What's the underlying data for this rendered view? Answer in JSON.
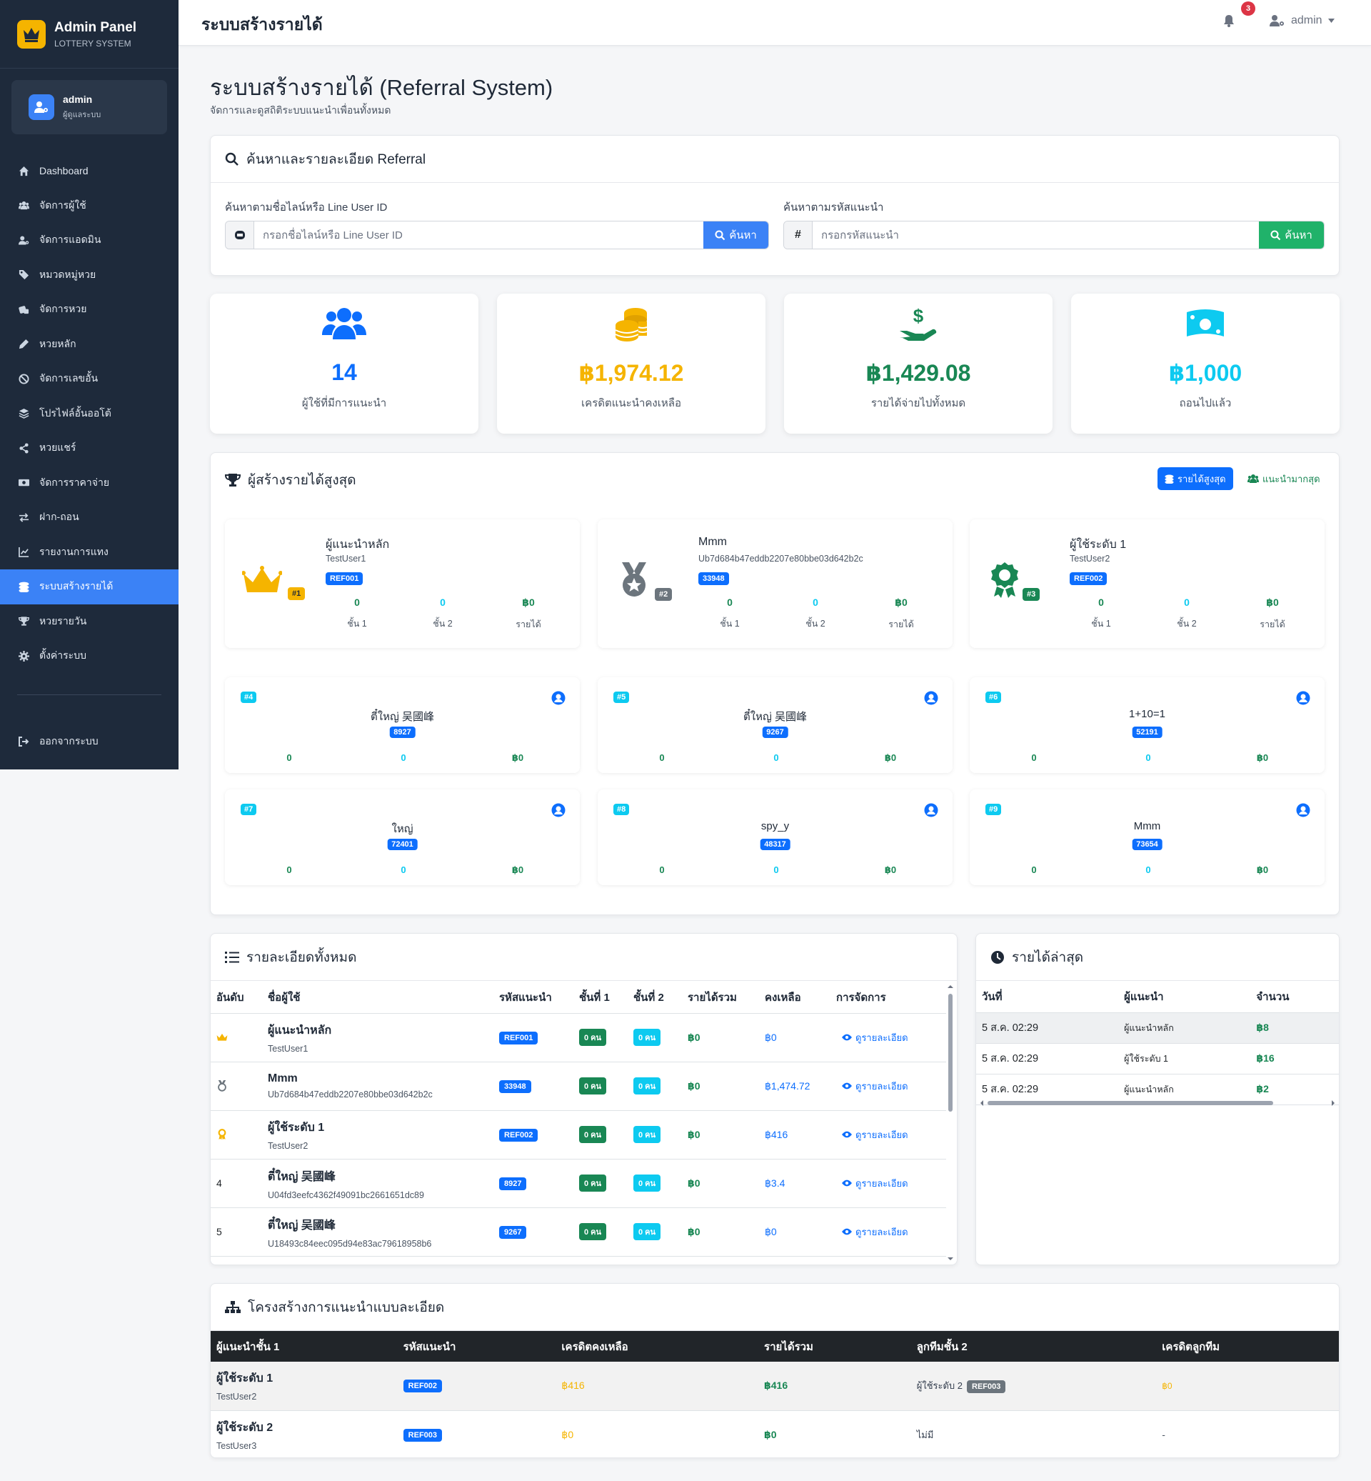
{
  "sidebar": {
    "brand_title": "Admin Panel",
    "brand_sub": "LOTTERY SYSTEM",
    "user_name": "admin",
    "user_role": "ผู้ดูแลระบบ",
    "items": [
      {
        "label": "Dashboard",
        "icon": "home-icon"
      },
      {
        "label": "จัดการผู้ใช้",
        "icon": "users-icon"
      },
      {
        "label": "จัดการแอดมิน",
        "icon": "user-cog-icon"
      },
      {
        "label": "หมวดหมู่หวย",
        "icon": "tags-icon"
      },
      {
        "label": "จัดการหวย",
        "icon": "dice-icon"
      },
      {
        "label": "หวยหลัก",
        "icon": "pen-icon"
      },
      {
        "label": "จัดการเลขอั้น",
        "icon": "ban-icon"
      },
      {
        "label": "โปรไฟล์อั้นออโต้",
        "icon": "layers-icon"
      },
      {
        "label": "หวยแชร์",
        "icon": "share-icon"
      },
      {
        "label": "จัดการราคาจ่าย",
        "icon": "money-icon"
      },
      {
        "label": "ฝาก-ถอน",
        "icon": "exchange-icon"
      },
      {
        "label": "รายงานการแทง",
        "icon": "chart-line-icon"
      },
      {
        "label": "ระบบสร้างรายได้",
        "icon": "coins-icon",
        "active": true
      },
      {
        "label": "หวยรายวัน",
        "icon": "trophy-icon"
      },
      {
        "label": "ตั้งค่าระบบ",
        "icon": "gear-icon"
      }
    ],
    "logout_label": "ออกจากระบบ"
  },
  "topbar": {
    "title": "ระบบสร้างรายได้",
    "notif_count": "3",
    "user_label": "admin"
  },
  "page": {
    "title": "ระบบสร้างรายได้ (Referral System)",
    "subtitle": "จัดการและดูสถิติระบบแนะนำเพื่อนทั้งหมด"
  },
  "search": {
    "title": "ค้นหาและรายละเอียด Referral",
    "line_label": "ค้นหาตามชื่อไลน์หรือ Line User ID",
    "line_placeholder": "กรอกชื่อไลน์หรือ Line User ID",
    "code_label": "ค้นหาตามรหัสแนะนำ",
    "code_prefix": "#",
    "code_placeholder": "กรอกรหัสแนะนำ",
    "button": "ค้นหา"
  },
  "stats": [
    {
      "value": "14",
      "label": "ผู้ใช้ที่มีการแนะนำ",
      "color": "#0d6efd",
      "icon": "users-icon"
    },
    {
      "value": "฿1,974.12",
      "label": "เครดิตแนะนำคงเหลือ",
      "color": "#f5b400",
      "icon": "coins-icon"
    },
    {
      "value": "฿1,429.08",
      "label": "รายได้จ่ายไปทั้งหมด",
      "color": "#198754",
      "icon": "hand-dollar-icon"
    },
    {
      "value": "฿1,000",
      "label": "ถอนไปแล้ว",
      "color": "#0dcaf0",
      "icon": "money-bill-icon"
    }
  ],
  "top": {
    "title": "ผู้สร้างรายได้สูงสุด",
    "tab_income": "รายได้สูงสุด",
    "tab_referrals": "แนะนำมากสุด",
    "stat_labels": {
      "l1": "ชั้น 1",
      "l2": "ชั้น 2",
      "income": "รายได้"
    },
    "podium": [
      {
        "rank": "#1",
        "name": "ผู้แนะนำหลัก",
        "sub": "TestUser1",
        "code": "REF001",
        "l1": "0",
        "l2": "0",
        "income": "฿0"
      },
      {
        "rank": "#2",
        "name": "Mmm",
        "sub": "Ub7d684b47eddb2207e80bbe03d642b2c",
        "code": "33948",
        "l1": "0",
        "l2": "0",
        "income": "฿0"
      },
      {
        "rank": "#3",
        "name": "ผู้ใช้ระดับ 1",
        "sub": "TestUser2",
        "code": "REF002",
        "l1": "0",
        "l2": "0",
        "income": "฿0"
      }
    ],
    "others": [
      {
        "rank": "#4",
        "name": "ตี๋ใหญ่ 吴國峰",
        "code": "8927",
        "l1": "0",
        "l2": "0",
        "income": "฿0"
      },
      {
        "rank": "#5",
        "name": "ตี๋ใหญ่ 吴國峰",
        "code": "9267",
        "l1": "0",
        "l2": "0",
        "income": "฿0"
      },
      {
        "rank": "#6",
        "name": "1+10=1",
        "code": "52191",
        "l1": "0",
        "l2": "0",
        "income": "฿0"
      },
      {
        "rank": "#7",
        "name": "ใหญ่",
        "code": "72401",
        "l1": "0",
        "l2": "0",
        "income": "฿0"
      },
      {
        "rank": "#8",
        "name": "spy_y",
        "code": "48317",
        "l1": "0",
        "l2": "0",
        "income": "฿0"
      },
      {
        "rank": "#9",
        "name": "Mmm",
        "code": "73654",
        "l1": "0",
        "l2": "0",
        "income": "฿0"
      }
    ]
  },
  "details": {
    "title": "รายละเอียดทั้งหมด",
    "columns": [
      "อันดับ",
      "ชื่อผู้ใช้",
      "รหัสแนะนำ",
      "ชั้นที่ 1",
      "ชั้นที่ 2",
      "รายได้รวม",
      "คงเหลือ",
      "การจัดการ"
    ],
    "action_label": "ดูรายละเอียด",
    "rows": [
      {
        "rank": "crown-icon",
        "name": "ผู้แนะนำหลัก",
        "sub": "TestUser1",
        "code": "REF001",
        "l1": "0 คน",
        "l2": "0 คน",
        "income": "฿0",
        "balance": "฿0"
      },
      {
        "rank": "medal-icon",
        "name": "Mmm",
        "sub": "Ub7d684b47eddb2207e80bbe03d642b2c",
        "code": "33948",
        "l1": "0 คน",
        "l2": "0 คน",
        "income": "฿0",
        "balance": "฿1,474.72"
      },
      {
        "rank": "award-icon",
        "name": "ผู้ใช้ระดับ 1",
        "sub": "TestUser2",
        "code": "REF002",
        "l1": "0 คน",
        "l2": "0 คน",
        "income": "฿0",
        "balance": "฿416"
      },
      {
        "rank": "4",
        "name": "ตี๋ใหญ่ 吴國峰",
        "sub": "U04fd3eefc4362f49091bc2661651dc89",
        "code": "8927",
        "l1": "0 คน",
        "l2": "0 คน",
        "income": "฿0",
        "balance": "฿3.4"
      },
      {
        "rank": "5",
        "name": "ตี๋ใหญ่ 吴國峰",
        "sub": "U18493c84eec095d94e83ac79618958b6",
        "code": "9267",
        "l1": "0 คน",
        "l2": "0 คน",
        "income": "฿0",
        "balance": "฿0"
      }
    ]
  },
  "recent": {
    "title": "รายได้ล่าสุด",
    "columns": [
      "วันที่",
      "ผู้แนะนำ",
      "จำนวน"
    ],
    "rows": [
      {
        "date": "5 ส.ค. 02:29",
        "ref": "ผู้แนะนำหลัก",
        "amount": "฿8"
      },
      {
        "date": "5 ส.ค. 02:29",
        "ref": "ผู้ใช้ระดับ 1",
        "amount": "฿16"
      },
      {
        "date": "5 ส.ค. 02:29",
        "ref": "ผู้แนะนำหลัก",
        "amount": "฿2"
      }
    ]
  },
  "structure": {
    "title": "โครงสร้างการแนะนำแบบละเอียด",
    "columns": [
      "ผู้แนะนำชั้น 1",
      "รหัสแนะนำ",
      "เครดิตคงเหลือ",
      "รายได้รวม",
      "ลูกทีมชั้น 2",
      "เครดิตลูกทีม"
    ],
    "rows": [
      {
        "name": "ผู้ใช้ระดับ 1",
        "sub": "TestUser2",
        "code": "REF002",
        "credit": "฿416",
        "income": "฿416",
        "child": "ผู้ใช้ระดับ 2",
        "child_code": "REF003",
        "child_credit": "฿0"
      },
      {
        "name": "ผู้ใช้ระดับ 2",
        "sub": "TestUser3",
        "code": "REF003",
        "credit": "฿0",
        "income": "฿0",
        "child": "ไม่มี",
        "child_code": "",
        "child_credit": "-"
      }
    ]
  }
}
